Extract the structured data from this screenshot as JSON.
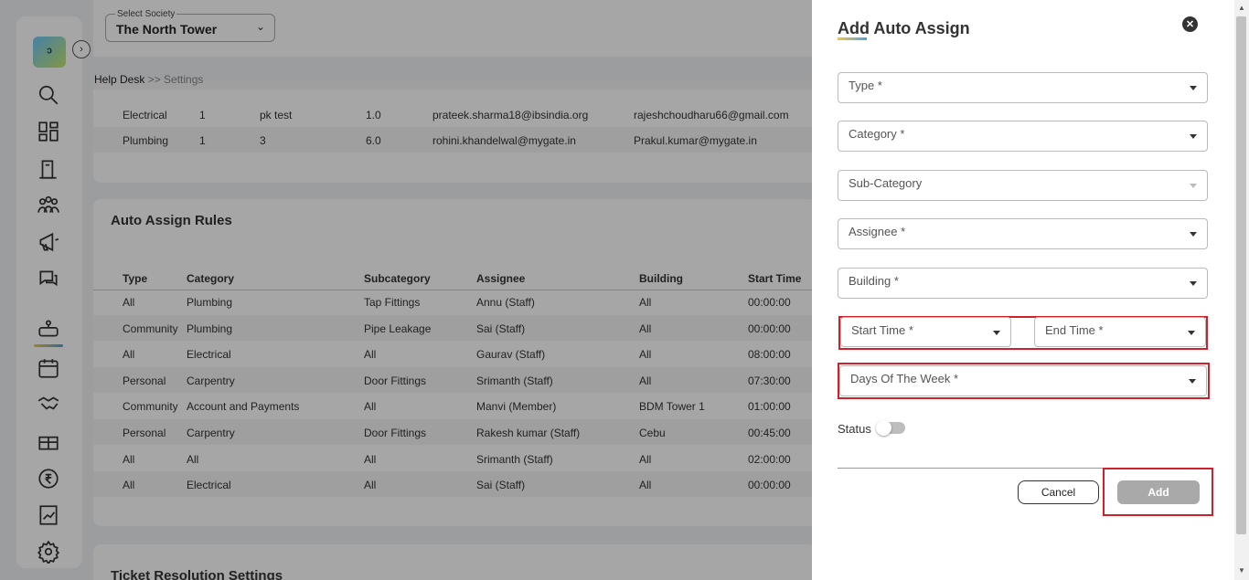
{
  "society": {
    "label": "Select Society",
    "value": "The North Tower"
  },
  "breadcrumb": {
    "root": "Help Desk",
    "sep": " >> ",
    "current": "Settings"
  },
  "top_table": {
    "rows": [
      [
        "Electrical",
        "1",
        "pk test",
        "1.0",
        "prateek.sharma18@ibsindia.org",
        "rajeshchoudharu66@gmail.com"
      ],
      [
        "Plumbing",
        "1",
        "3",
        "6.0",
        "rohini.khandelwal@mygate.in",
        "Prakul.kumar@mygate.in"
      ]
    ]
  },
  "auto_assign": {
    "title": "Auto Assign Rules",
    "headers": [
      "Type",
      "Category",
      "Subcategory",
      "Assignee",
      "Building",
      "Start Time"
    ],
    "rows": [
      [
        "All",
        "Plumbing",
        "Tap Fittings",
        "Annu (Staff)",
        "All",
        "00:00:00"
      ],
      [
        "Community",
        "Plumbing",
        "Pipe Leakage",
        "Sai (Staff)",
        "All",
        "00:00:00"
      ],
      [
        "All",
        "Electrical",
        "All",
        "Gaurav (Staff)",
        "All",
        "08:00:00"
      ],
      [
        "Personal",
        "Carpentry",
        "Door Fittings",
        "Srimanth (Staff)",
        "All",
        "07:30:00"
      ],
      [
        "Community",
        "Account and Payments",
        "All",
        "Manvi (Member)",
        "BDM Tower 1",
        "01:00:00"
      ],
      [
        "Personal",
        "Carpentry",
        "Door Fittings",
        "Rakesh kumar (Staff)",
        "Cebu",
        "00:45:00"
      ],
      [
        "All",
        "All",
        "All",
        "Srimanth (Staff)",
        "All",
        "02:00:00"
      ],
      [
        "All",
        "Electrical",
        "All",
        "Sai (Staff)",
        "All",
        "00:00:00"
      ]
    ]
  },
  "ticket_resolution": {
    "title": "Ticket Resolution Settings"
  },
  "drawer": {
    "title": "Add Auto Assign",
    "fields": {
      "type": "Type *",
      "category": "Category *",
      "subcategory": "Sub-Category",
      "assignee": "Assignee *",
      "building": "Building *",
      "start_time": "Start Time *",
      "end_time": "End Time *",
      "days": "Days Of The Week *"
    },
    "status_label": "Status",
    "status_on": false,
    "cancel_label": "Cancel",
    "add_label": "Add"
  },
  "icons": {
    "logo": "app-logo",
    "close": "close-icon",
    "highlight_color": "#d0202a"
  }
}
